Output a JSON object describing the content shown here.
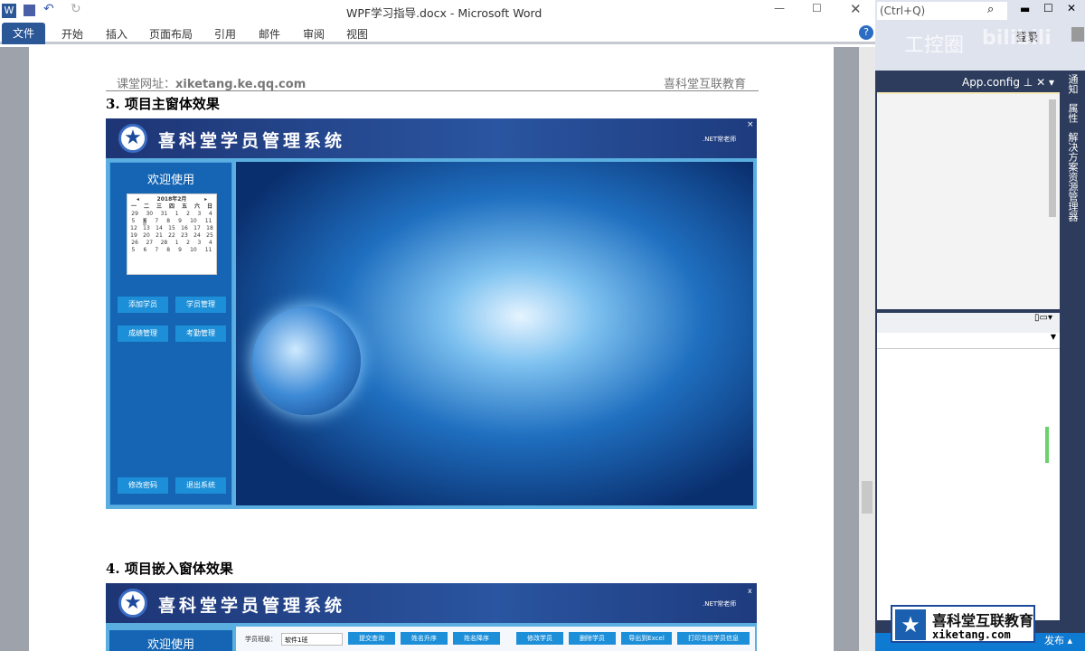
{
  "window": {
    "title": "WPF学习指导.docx - Microsoft Word"
  },
  "ribbon": {
    "tabs": [
      "文件",
      "开始",
      "插入",
      "页面布局",
      "引用",
      "邮件",
      "审阅",
      "视图"
    ]
  },
  "doc": {
    "header_left_label": "课堂网址：",
    "header_left_url": "xiketang.ke.qq.com",
    "header_right": "喜科堂互联教育",
    "heading3": "3.  项目主窗体效果",
    "heading4": "4.  项目嵌入窗体效果",
    "shot1": {
      "title": "喜科堂学员管理系统",
      "user": ".NET常老师",
      "close": "×",
      "welcome": "欢迎使用",
      "calendar": {
        "month": "2018年2月",
        "weekdays": [
          "一",
          "二",
          "三",
          "四",
          "五",
          "六",
          "日"
        ],
        "weeks": [
          [
            "29",
            "30",
            "31",
            "1",
            "2",
            "3",
            "4"
          ],
          [
            "5",
            "6",
            "7",
            "8",
            "9",
            "10",
            "11"
          ],
          [
            "12",
            "13",
            "14",
            "15",
            "16",
            "17",
            "18"
          ],
          [
            "19",
            "20",
            "21",
            "22",
            "23",
            "24",
            "25"
          ],
          [
            "26",
            "27",
            "28",
            "1",
            "2",
            "3",
            "4"
          ],
          [
            "5",
            "6",
            "7",
            "8",
            "9",
            "10",
            "11"
          ]
        ]
      },
      "buttons": [
        "添加学员",
        "学员管理",
        "成绩管理",
        "考勤管理"
      ],
      "bottom_buttons": [
        "修改密码",
        "退出系统"
      ]
    },
    "shot2": {
      "title": "喜科堂学员管理系统",
      "user": ".NET常老师",
      "close": "x",
      "welcome": "欢迎使用",
      "class_label": "学员班级：",
      "class_value": "软件1班",
      "toolbar": [
        "提交查询",
        "姓名升序",
        "姓名降序",
        "修改学员",
        "删除学员",
        "导出到Excel",
        "打印当前学员信息"
      ]
    }
  },
  "vs": {
    "search": "(Ctrl+Q)",
    "login": "登录",
    "tab": "App.config",
    "side_tabs": [
      "通知",
      "属性",
      "解决方案资源管理器"
    ],
    "status": "发布"
  },
  "watermark": {
    "brand_cn": "喜科堂互联教育",
    "brand_url": "xiketang.com",
    "wm1": "工控圈",
    "wm2": "bilibili"
  }
}
